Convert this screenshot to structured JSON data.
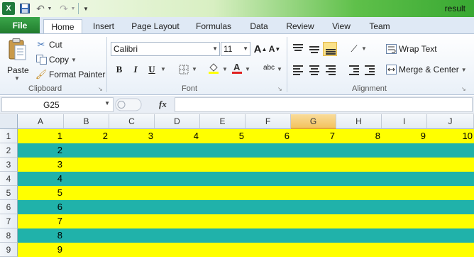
{
  "window": {
    "title": "result"
  },
  "quick_access": {
    "logo": "X"
  },
  "tabs": [
    {
      "label": "File"
    },
    {
      "label": "Home"
    },
    {
      "label": "Insert"
    },
    {
      "label": "Page Layout"
    },
    {
      "label": "Formulas"
    },
    {
      "label": "Data"
    },
    {
      "label": "Review"
    },
    {
      "label": "View"
    },
    {
      "label": "Team"
    }
  ],
  "clipboard": {
    "paste": "Paste",
    "cut": "Cut",
    "copy": "Copy",
    "format_painter": "Format Painter",
    "group": "Clipboard"
  },
  "font": {
    "name": "Calibri",
    "size": "11",
    "group": "Font",
    "grow": "A",
    "shrink": "A",
    "bold": "B",
    "italic": "I",
    "underline": "U",
    "phonetic": "abc"
  },
  "alignment": {
    "wrap_text": "Wrap Text",
    "merge_center": "Merge & Center",
    "group": "Alignment"
  },
  "formula_bar": {
    "name_box": "G25",
    "fx": "fx",
    "formula": ""
  },
  "sheet": {
    "columns": [
      "A",
      "B",
      "C",
      "D",
      "E",
      "F",
      "G",
      "H",
      "I",
      "J"
    ],
    "selected_column": "G",
    "row_headers": [
      "1",
      "2",
      "3",
      "4",
      "5",
      "6",
      "7",
      "8",
      "9"
    ],
    "row_colors": [
      "#ffff00",
      "#20b2aa",
      "#ffff00",
      "#20b2aa",
      "#ffff00",
      "#20b2aa",
      "#ffff00",
      "#20b2aa",
      "#ffff00"
    ],
    "row1_values": [
      "1",
      "2",
      "3",
      "4",
      "5",
      "6",
      "7",
      "8",
      "9",
      "10"
    ],
    "col_a_values": [
      "1",
      "2",
      "3",
      "4",
      "5",
      "6",
      "7",
      "8",
      "9"
    ]
  }
}
